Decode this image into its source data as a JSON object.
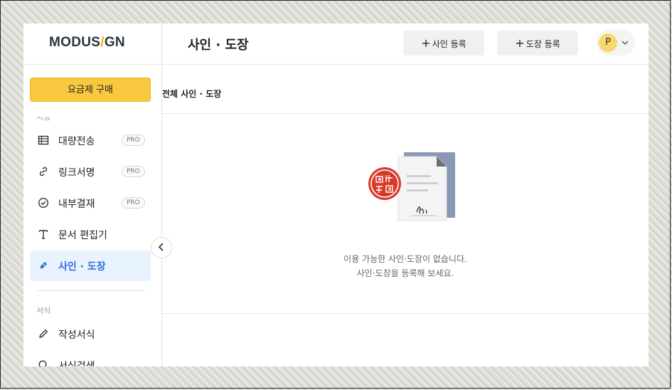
{
  "logo": {
    "left": "MODUS",
    "slash": "/",
    "right": "GN"
  },
  "sidebar": {
    "buy_label": "요금제 구매",
    "section_cut_label": "서명",
    "items": [
      {
        "label": "대량전송",
        "badge": "PRO",
        "icon": "table-icon"
      },
      {
        "label": "링크서명",
        "badge": "PRO",
        "icon": "link-icon"
      },
      {
        "label": "내부결재",
        "badge": "PRO",
        "icon": "check-circle-icon"
      },
      {
        "label": "문서 편집기",
        "badge": "",
        "icon": "text-icon"
      },
      {
        "label": "사인 · 도장",
        "badge": "",
        "icon": "pen-icon",
        "active": true
      }
    ],
    "section2_label": "서식",
    "items2": [
      {
        "label": "작성서식",
        "icon": "pencil-icon"
      },
      {
        "label": "서식검색",
        "icon": "search-icon"
      }
    ]
  },
  "header": {
    "title": "사인 · 도장",
    "add_sign_label": "사인 등록",
    "add_stamp_label": "도장 등록",
    "plus": "+",
    "avatar_initial": "P"
  },
  "content": {
    "subtitle": "전체 사인 · 도장",
    "empty_line1": "이용 가능한 사인·도장이 없습니다.",
    "empty_line2": "사인·도장을 등록해 보세요."
  },
  "colors": {
    "accent_yellow": "#f8c93e",
    "active_blue": "#2d6fd8",
    "stamp_red": "#d63a2b",
    "doc_shadow": "#8a98b6"
  }
}
